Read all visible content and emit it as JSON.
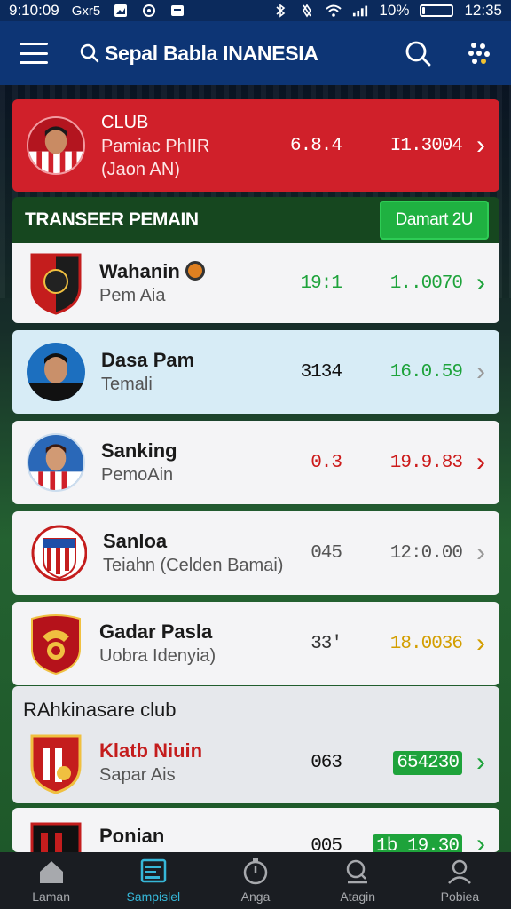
{
  "status_bar": {
    "time_left": "9:10:09",
    "carrier": "Gxr5",
    "battery_percent": "10%",
    "battery_level": 0.1,
    "time_right": "12:35"
  },
  "app_bar": {
    "title": "Sepal Babla INANESIA"
  },
  "club_card": {
    "title": "CLUB",
    "name": "Pamiac PhIIR",
    "sub": "(Jaon AN)",
    "value1": "6.8.4",
    "value2": "I1.3004"
  },
  "transfer_section": {
    "title": "TRANSEER PEMAIN",
    "button_label": "Damart 2U"
  },
  "players": [
    {
      "name": "Wahanin",
      "sub": "Pem Aia",
      "value1": "19:1",
      "value2": "1..0070",
      "color1": "#1ea33b",
      "color2": "#1ea33b",
      "chevron_color": "#1ea33b"
    },
    {
      "name": "Dasa Pam",
      "sub": "Temali",
      "value1": "3134",
      "value2": "16.0.59",
      "color1": "#111111",
      "color2": "#1ea33b",
      "chevron_color": "#888888"
    },
    {
      "name": "Sanking",
      "sub": "PemoAin",
      "value1": "0.3",
      "value2": "19.9.83",
      "color1": "#cc1a1a",
      "color2": "#cc1a1a",
      "chevron_color": "#cc1a1a"
    },
    {
      "name": "Sanloa",
      "sub": "Teiahn (Celden Bamai)",
      "value1": "045",
      "value2": "12:0.00",
      "color1": "#555555",
      "color2": "#555555",
      "chevron_color": "#888888"
    },
    {
      "name": "Gadar Pasla",
      "sub": "Uobra Idenyia)",
      "value1": "33'",
      "value2": "18.0036",
      "color1": "#333333",
      "color2": "#d39e00",
      "chevron_color": "#d39e00"
    }
  ],
  "club_section": {
    "title": "RAhkinasare club",
    "clubs": [
      {
        "name": "Klatb Niuin",
        "sub": "Sapar Ais",
        "value1": "063",
        "value2": "654230"
      },
      {
        "name": "Ponian",
        "sub": "",
        "value1": "005",
        "value2": "1b 19.30"
      }
    ]
  },
  "bottom_nav": [
    {
      "label": "Laman",
      "icon": "home-icon",
      "active": false
    },
    {
      "label": "Sampislel",
      "icon": "stats-icon",
      "active": true
    },
    {
      "label": "Anga",
      "icon": "timer-icon",
      "active": false
    },
    {
      "label": "Atagin",
      "icon": "search-icon",
      "active": false
    },
    {
      "label": "Pobiea",
      "icon": "profile-icon",
      "active": false
    }
  ]
}
